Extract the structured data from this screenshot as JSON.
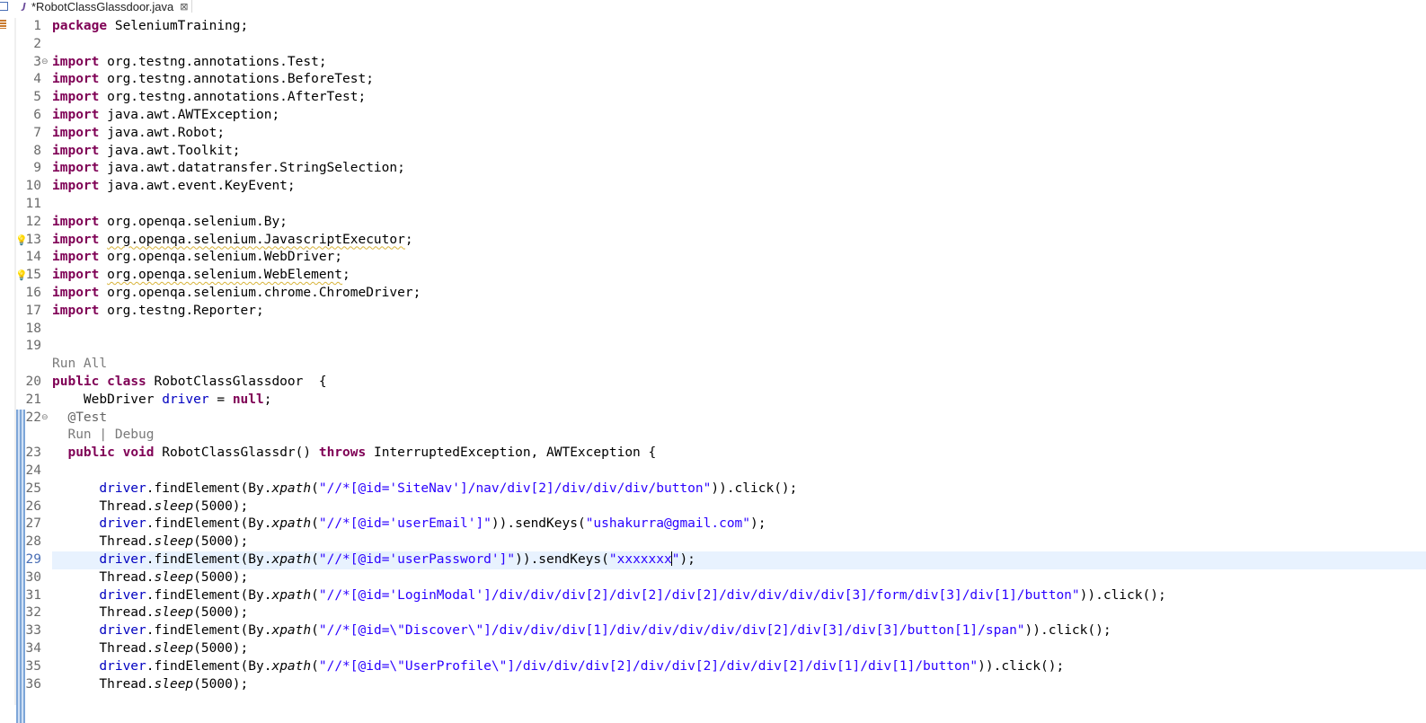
{
  "tab": {
    "title": "*RobotClassGlassdoor.java",
    "close": "⊠"
  },
  "lines": {
    "l1": "1",
    "l2": "2",
    "l3": "3",
    "l4": "4",
    "l5": "5",
    "l6": "6",
    "l7": "7",
    "l8": "8",
    "l9": "9",
    "l10": "10",
    "l11": "11",
    "l12": "12",
    "l13": "13",
    "l14": "14",
    "l15": "15",
    "l16": "16",
    "l17": "17",
    "l18": "18",
    "l19": "19",
    "l20": "20",
    "l21": "21",
    "l22": "22",
    "l23": "23",
    "l24": "24",
    "l25": "25",
    "l26": "26",
    "l27": "27",
    "l28": "28",
    "l29": "29",
    "l30": "30",
    "l31": "31",
    "l32": "32",
    "l33": "33",
    "l34": "34",
    "l35": "35",
    "l36": "36"
  },
  "code": {
    "kw_package": "package",
    "kw_import": "import",
    "kw_public": "public",
    "kw_class": "class",
    "kw_null": "null",
    "kw_void": "void",
    "kw_throws": "throws",
    "pkg_name": " SeleniumTraining;",
    "imp1": " org.testng.annotations.Test;",
    "imp2": " org.testng.annotations.BeforeTest;",
    "imp3": " org.testng.annotations.AfterTest;",
    "imp4": " java.awt.AWTException;",
    "imp5": " java.awt.Robot;",
    "imp6": " java.awt.Toolkit;",
    "imp7": " java.awt.datatransfer.StringSelection;",
    "imp8": " java.awt.event.KeyEvent;",
    "imp9": " org.openqa.selenium.By;",
    "imp10": "org.openqa.selenium.JavascriptExecutor",
    "imp11": " org.openqa.selenium.WebDriver;",
    "imp12": "org.openqa.selenium.WebElement",
    "imp13": " org.openqa.selenium.chrome.ChromeDriver;",
    "imp14": " org.testng.Reporter;",
    "semi": ";",
    "run_all": "Run All",
    "class_decl": " RobotClassGlassdoor  {",
    "driver_type": "    WebDriver ",
    "driver_field": "driver",
    "driver_assign": " = ",
    "ann_test": "  @Test",
    "run_debug": "  Run | Debug",
    "method_sig": " RobotClassGlassdr() ",
    "method_exc": " InterruptedException, AWTException {",
    "indent": "      ",
    "find": ".findElement(By.",
    "xpath": "xpath",
    "open": "(",
    "click_end": ")).click();",
    "send_mid": ")).sendKeys(",
    "send_end": ");",
    "thread": "Thread.",
    "sleep": "sleep",
    "sleep_arg": "(5000);",
    "xp1": "\"//*[@id='SiteNav']/nav/div[2]/div/div/div/button\"",
    "xp2": "\"//*[@id='userEmail']\"",
    "val2": "\"ushakurra@gmail.com\"",
    "xp3": "\"//*[@id='userPassword']\"",
    "val3a": "\"xxxxxxx",
    "val3b": "\"",
    "xp4": "\"//*[@id='LoginModal']/div/div/div[2]/div[2]/div[2]/div/div/div/div[3]/form/div[3]/div[1]/button\"",
    "xp5": "\"//*[@id=\\\"Discover\\\"]/div/div/div[1]/div/div/div/div/div[2]/div[3]/div[3]/button[1]/span\"",
    "xp6": "\"//*[@id=\\\"UserProfile\\\"]/div/div/div[2]/div/div[2]/div/div[2]/div[1]/div[1]/button\""
  }
}
